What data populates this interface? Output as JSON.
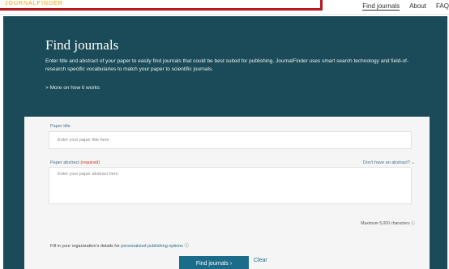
{
  "header": {
    "logo_text": "JOURNALFINDER",
    "nav": [
      {
        "label": "Find journals",
        "active": true
      },
      {
        "label": "About",
        "active": false
      },
      {
        "label": "FAQ",
        "active": false
      }
    ],
    "accent_color": "#b7181f"
  },
  "hero": {
    "title": "Find journals",
    "intro": "Enter title and abstract of your paper to easily find journals that could be best suited for publishing. JournalFinder uses smart search technology and field-of-research specific vocabularies to match your paper to scientific journals.",
    "more_link": "> More on how it works",
    "background_color": "#1b4b58"
  },
  "form": {
    "title_label": "Paper title",
    "title_placeholder": "Enter your paper title here",
    "abstract_label": "Paper abstract",
    "abstract_required": "(required)",
    "abstract_placeholder": "Enter your paper abstract here",
    "dont_have_abstract": "Don't have an abstract?",
    "max_chars": "Maximum 5,000 characters",
    "org_text": "Fill in your organization's details for",
    "org_link": "personalized publishing options",
    "find_button": "Find journals",
    "clear_button": "Clear"
  }
}
